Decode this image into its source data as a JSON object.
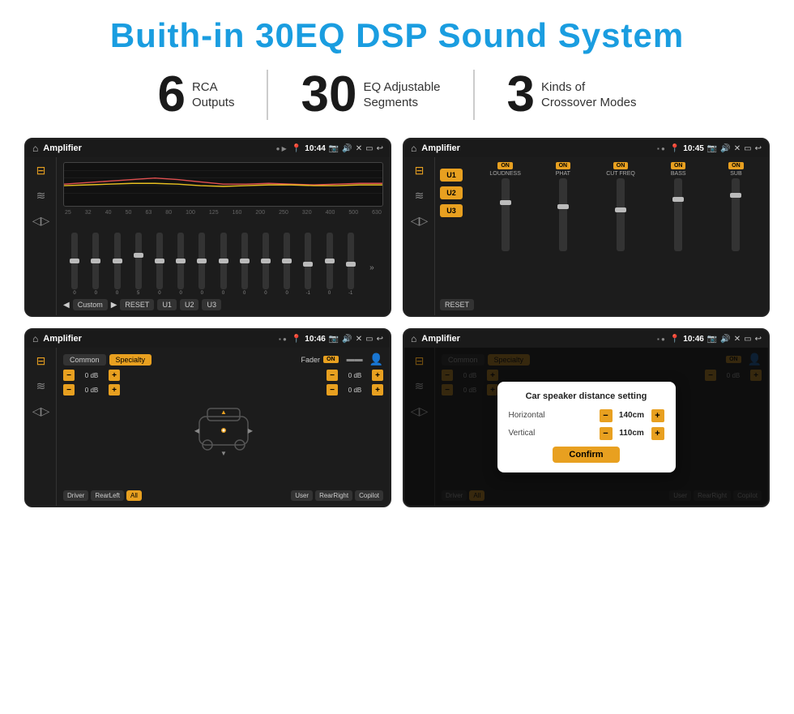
{
  "page": {
    "title": "Buith-in 30EQ DSP Sound System",
    "stats": [
      {
        "number": "6",
        "text": "RCA\nOutputs"
      },
      {
        "number": "30",
        "text": "EQ Adjustable\nSegments"
      },
      {
        "number": "3",
        "text": "Kinds of\nCrossover Modes"
      }
    ],
    "screens": [
      {
        "id": "eq-screen",
        "statusBar": {
          "appTitle": "Amplifier",
          "time": "10:44"
        },
        "type": "eq",
        "frequencies": [
          "25",
          "32",
          "40",
          "50",
          "63",
          "80",
          "100",
          "125",
          "160",
          "200",
          "250",
          "320",
          "400",
          "500",
          "630"
        ],
        "values": [
          "0",
          "0",
          "0",
          "5",
          "0",
          "0",
          "0",
          "0",
          "0",
          "0",
          "0",
          "-1",
          "0",
          "-1"
        ],
        "presetName": "Custom",
        "buttons": [
          "RESET",
          "U1",
          "U2",
          "U3"
        ]
      },
      {
        "id": "crossover-screen",
        "statusBar": {
          "appTitle": "Amplifier",
          "time": "10:45"
        },
        "type": "crossover",
        "presets": [
          "U1",
          "U2",
          "U3"
        ],
        "channels": [
          {
            "label": "LOUDNESS",
            "on": true
          },
          {
            "label": "PHAT",
            "on": true
          },
          {
            "label": "CUT FREQ",
            "on": true
          },
          {
            "label": "BASS",
            "on": true
          },
          {
            "label": "SUB",
            "on": true
          }
        ]
      },
      {
        "id": "fader-screen",
        "statusBar": {
          "appTitle": "Amplifier",
          "time": "10:46"
        },
        "type": "fader",
        "tabs": [
          "Common",
          "Specialty"
        ],
        "faderLabel": "Fader",
        "controls": {
          "topLeft1": "0 dB",
          "topLeft2": "0 dB",
          "topRight1": "0 dB",
          "topRight2": "0 dB"
        },
        "locations": [
          "Driver",
          "RearLeft",
          "All",
          "User",
          "RearRight",
          "Copilot"
        ]
      },
      {
        "id": "dialog-screen",
        "statusBar": {
          "appTitle": "Amplifier",
          "time": "10:46"
        },
        "type": "fader-dialog",
        "dialog": {
          "title": "Car speaker distance setting",
          "horizontal": {
            "label": "Horizontal",
            "value": "140cm"
          },
          "vertical": {
            "label": "Vertical",
            "value": "110cm"
          },
          "confirmLabel": "Confirm"
        },
        "bgControls": {
          "db1": "0 dB",
          "db2": "0 dB"
        }
      }
    ]
  }
}
